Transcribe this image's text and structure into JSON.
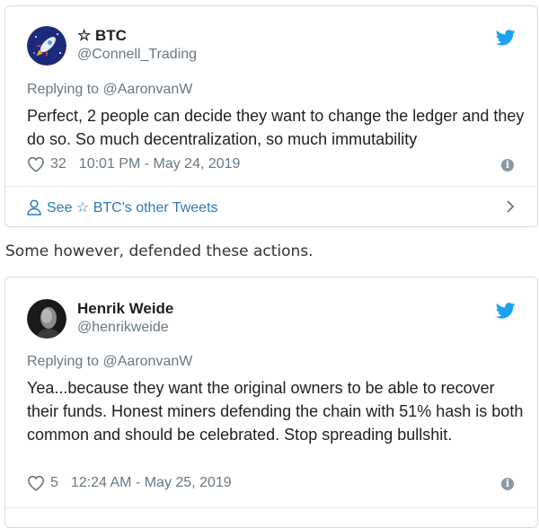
{
  "tweets": [
    {
      "display_name": "☆ BTC",
      "handle": "@Connell_Trading",
      "replying_prefix": "Replying to ",
      "replying_to": "@AaronvanW",
      "text": "Perfect, 2 people can decide they want to change the ledger and they do so. So much decentralization, so much immutability",
      "likes": "32",
      "timestamp": "10:01 PM - May 24, 2019",
      "see_more": "See ☆ BTC's other Tweets",
      "avatar_icon": "rocket-icon"
    },
    {
      "display_name": "Henrik Weide",
      "handle": "@henrikweide",
      "replying_prefix": "Replying to ",
      "replying_to": "@AaronvanW",
      "text": "Yea...because they want the original owners to be able to recover their funds. Honest miners defending the chain with 51% hash is both common and should be celebrated. Stop spreading bullshit.",
      "likes": "5",
      "timestamp": "12:24 AM - May 25, 2019",
      "avatar_icon": "person-photo-icon"
    }
  ],
  "article": {
    "paragraph": "Some however, defended these actions."
  },
  "colors": {
    "twitter_blue": "#1da1f2",
    "link_blue": "#2b7bb9",
    "muted_text": "#697882",
    "border": "#d9dde1"
  }
}
